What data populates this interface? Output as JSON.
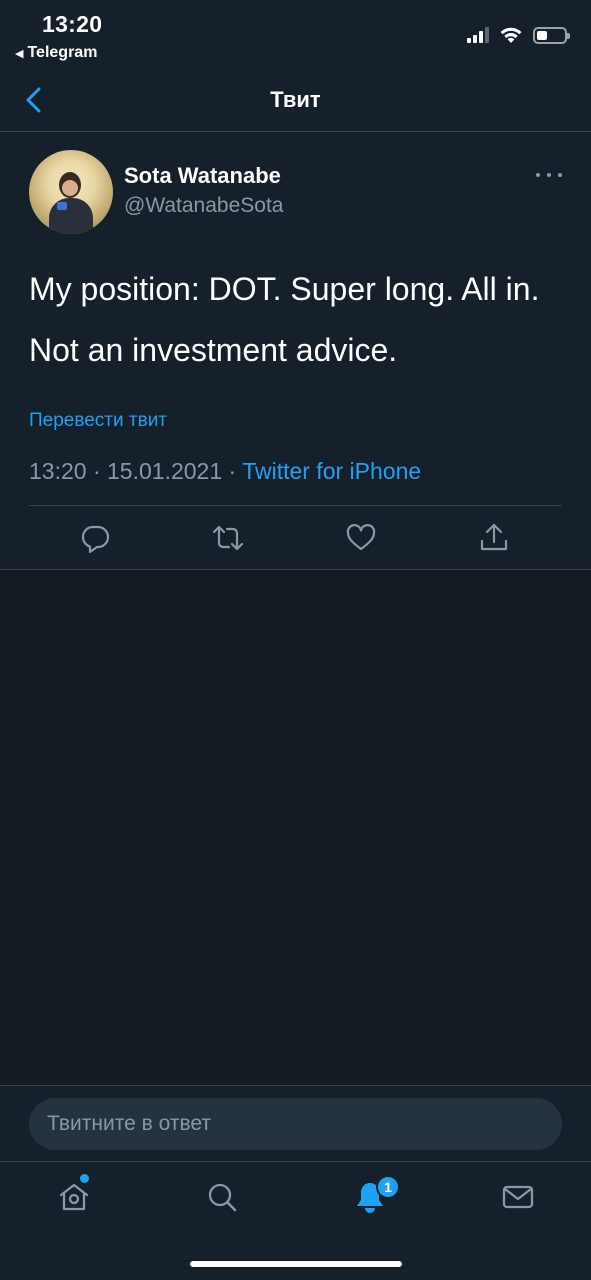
{
  "status_bar": {
    "time": "13:20",
    "back_app": "Telegram",
    "back_arrow": "◀",
    "battery_level": 0.38
  },
  "nav": {
    "title": "Твит",
    "back_icon": "chevron-left-icon"
  },
  "tweet": {
    "author_name": "Sota Watanabe",
    "author_handle": "@WatanabeSota",
    "text_line1": "My position: DOT. Super long. All in.",
    "text_line2": "Not an investment advice.",
    "translate_label": "Перевести твит",
    "time": "13:20",
    "date": "15.01.2021",
    "separator": "·",
    "client": "Twitter for iPhone"
  },
  "actions": {
    "reply_icon": "reply-icon",
    "retweet_icon": "retweet-icon",
    "like_icon": "heart-icon",
    "share_icon": "share-icon"
  },
  "reply": {
    "placeholder": "Твитните в ответ"
  },
  "tabbar": {
    "notifications_badge": "1"
  },
  "colors": {
    "accent": "#1da1f2",
    "background": "#15202b",
    "muted": "#8899a6",
    "border": "#38444d"
  }
}
